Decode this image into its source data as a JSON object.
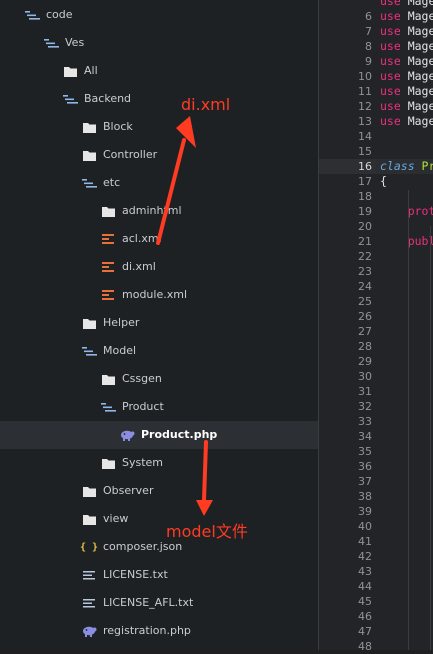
{
  "tree": [
    {
      "label": "code",
      "icon": "folder-open-icon",
      "indent": 0
    },
    {
      "label": "Ves",
      "icon": "folder-open-icon",
      "indent": 1
    },
    {
      "label": "All",
      "icon": "folder-icon",
      "indent": 2
    },
    {
      "label": "Backend",
      "icon": "folder-open-icon",
      "indent": 2
    },
    {
      "label": "Block",
      "icon": "folder-icon",
      "indent": 3
    },
    {
      "label": "Controller",
      "icon": "folder-icon",
      "indent": 3
    },
    {
      "label": "etc",
      "icon": "folder-open-icon",
      "indent": 3
    },
    {
      "label": "adminhtml",
      "icon": "folder-icon",
      "indent": 4
    },
    {
      "label": "acl.xml",
      "icon": "xml-file-icon",
      "indent": 4
    },
    {
      "label": "di.xml",
      "icon": "xml-file-icon",
      "indent": 4
    },
    {
      "label": "module.xml",
      "icon": "xml-file-icon",
      "indent": 4
    },
    {
      "label": "Helper",
      "icon": "folder-icon",
      "indent": 3
    },
    {
      "label": "Model",
      "icon": "folder-open-icon",
      "indent": 3
    },
    {
      "label": "Cssgen",
      "icon": "folder-icon",
      "indent": 4
    },
    {
      "label": "Product",
      "icon": "folder-open-icon",
      "indent": 4
    },
    {
      "label": "Product.php",
      "icon": "php-file-icon",
      "indent": 5,
      "selected": true
    },
    {
      "label": "System",
      "icon": "folder-icon",
      "indent": 4
    },
    {
      "label": "Observer",
      "icon": "folder-icon",
      "indent": 3
    },
    {
      "label": "view",
      "icon": "folder-icon",
      "indent": 3
    },
    {
      "label": "composer.json",
      "icon": "json-file-icon",
      "indent": 3
    },
    {
      "label": "LICENSE.txt",
      "icon": "text-file-icon",
      "indent": 3
    },
    {
      "label": "LICENSE_AFL.txt",
      "icon": "text-file-icon",
      "indent": 3
    },
    {
      "label": "registration.php",
      "icon": "php-file-icon",
      "indent": 3
    }
  ],
  "editor": {
    "line_numbers": [
      "",
      "6",
      "7",
      "8",
      "9",
      "10",
      "11",
      "12",
      "13",
      "14",
      "15",
      "16",
      "17",
      "18",
      "19",
      "20",
      "21",
      "22",
      "23",
      "24",
      "25",
      "26",
      "27",
      "28",
      "29",
      "30",
      "31",
      "32",
      "33",
      "34",
      "35",
      "36",
      "37",
      "38",
      "39",
      "40",
      "41",
      "42",
      "43",
      "44",
      "45",
      "46",
      "47",
      "48"
    ],
    "current_line": "16",
    "code_lines": [
      {
        "n": "",
        "parts": [
          {
            "t": "use",
            "c": "kw"
          },
          {
            "t": " Mage",
            "c": "wt"
          }
        ]
      },
      {
        "n": "6",
        "parts": [
          {
            "t": "use",
            "c": "kw"
          },
          {
            "t": " Mage",
            "c": "wt"
          }
        ]
      },
      {
        "n": "7",
        "parts": [
          {
            "t": "use",
            "c": "kw"
          },
          {
            "t": " Mage",
            "c": "wt"
          }
        ]
      },
      {
        "n": "8",
        "parts": [
          {
            "t": "use",
            "c": "kw"
          },
          {
            "t": " Mage",
            "c": "wt"
          }
        ]
      },
      {
        "n": "9",
        "parts": [
          {
            "t": "use",
            "c": "kw"
          },
          {
            "t": " Mage",
            "c": "wt"
          }
        ]
      },
      {
        "n": "10",
        "parts": [
          {
            "t": "use",
            "c": "kw"
          },
          {
            "t": " Mage",
            "c": "wt"
          }
        ]
      },
      {
        "n": "11",
        "parts": [
          {
            "t": "use",
            "c": "kw"
          },
          {
            "t": " Mage",
            "c": "wt"
          }
        ]
      },
      {
        "n": "12",
        "parts": [
          {
            "t": "use",
            "c": "kw"
          },
          {
            "t": " Mage",
            "c": "wt"
          }
        ]
      },
      {
        "n": "13",
        "parts": [
          {
            "t": "use",
            "c": "kw"
          },
          {
            "t": " Mage",
            "c": "wt"
          }
        ]
      },
      {
        "n": "16",
        "parts": [
          {
            "t": "class",
            "c": "cls"
          },
          {
            "t": " Pr",
            "c": "yl"
          }
        ]
      },
      {
        "n": "17",
        "parts": [
          {
            "t": "{",
            "c": "wt"
          }
        ]
      },
      {
        "n": "19",
        "parts": [
          {
            "t": "    prot",
            "c": "kw"
          }
        ]
      },
      {
        "n": "21",
        "parts": [
          {
            "t": "    publ",
            "c": "kw"
          }
        ]
      }
    ]
  },
  "annotations": {
    "di": "di.xml",
    "model": "model文件"
  },
  "colors": {
    "folder": "#e6e6e6",
    "folder_open": "#8fb8e8",
    "xml": "#e8713a",
    "php": "#8b8ee0",
    "json": "#e5c04a",
    "text": "#b8c6e0",
    "arrow": "#ff3b22"
  }
}
